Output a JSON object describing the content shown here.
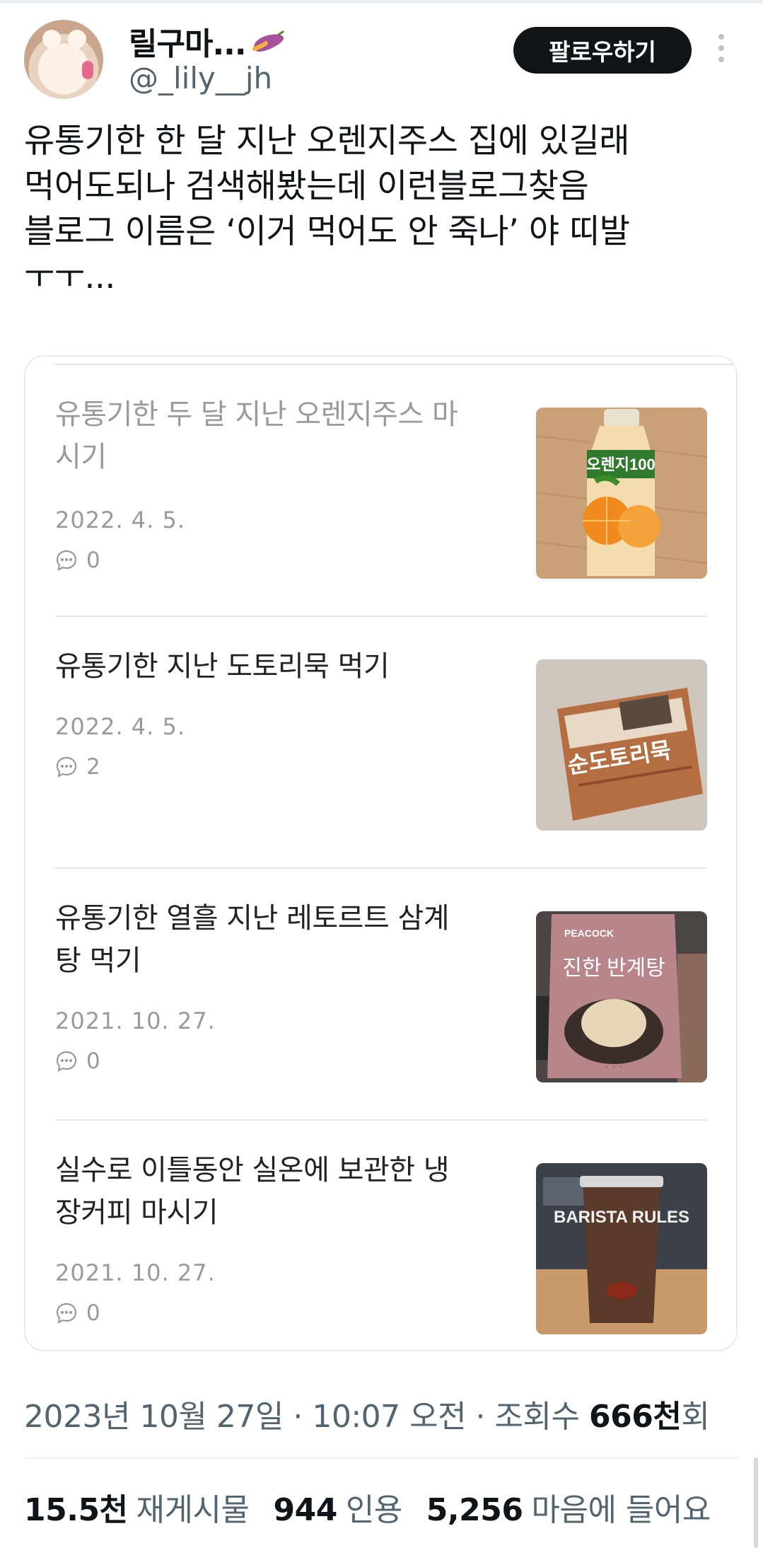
{
  "profile": {
    "display_name": "릴구마...",
    "handle": "@_lily__jh",
    "avatar_icon": "bear-avatar",
    "name_emoji_icon": "sweet-potato-icon"
  },
  "follow_button": {
    "label": "팔로우하기"
  },
  "more_icon": "more-vertical-icon",
  "tweet": {
    "text": "유통기한 한 달 지난 오렌지주스 집에 있길래\n먹어도되나 검색해봤는데 이런블로그찾음\n블로그 이름은 ‘이거 먹어도 안 죽나’ 야 띠발\nㅜㅜ..."
  },
  "blog_posts": [
    {
      "title": "유통기한 두 달 지난 오렌지주스 마\n시기",
      "date": "2022. 4. 5.",
      "comments": "0",
      "thumb_label": "오렌지100"
    },
    {
      "title": "유통기한 지난 도토리묵 먹기",
      "date": "2022. 4. 5.",
      "comments": "2",
      "thumb_label": "순도토리묵"
    },
    {
      "title": "유통기한 열흘 지난 레토르트 삼계\n탕 먹기",
      "date": "2021. 10. 27.",
      "comments": "0",
      "thumb_label": "진한 반계탕",
      "thumb_brand": "PEACOCK"
    },
    {
      "title": "실수로 이틀동안 실온에 보관한 냉\n장커피 마시기",
      "date": "2021. 10. 27.",
      "comments": "0",
      "thumb_label": "BARISTA RULES"
    }
  ],
  "meta": {
    "timestamp": "2023년 10월 27일 · 10:07 오전 · 조회수",
    "views": "666천",
    "views_suffix": "회"
  },
  "stats": {
    "retweets_count": "15.5천",
    "retweets_label": "재게시물",
    "quotes_count": "944",
    "quotes_label": "인용",
    "likes_count": "5,256",
    "likes_label": "마음에 들어요"
  },
  "colors": {
    "accent": "#0f1419",
    "secondary_text": "#536471",
    "card_border": "#e6ecf0"
  }
}
